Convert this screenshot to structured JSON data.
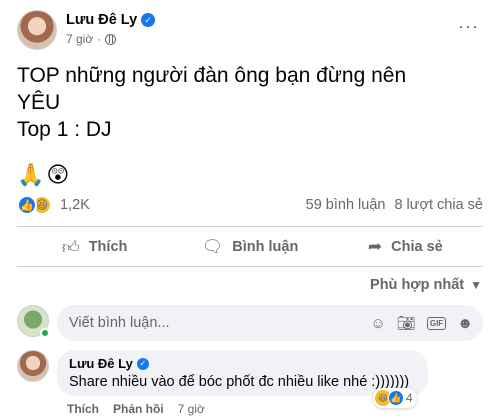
{
  "post": {
    "author": "Lưu Đê Ly",
    "time": "7 giờ",
    "more": "···",
    "line1": "TOP những người đàn ông bạn đừng nên",
    "line2": "YÊU",
    "line3": "Top 1 : DJ",
    "emojis": "🙏😲"
  },
  "reactions": {
    "count": "1,2K",
    "comments": "59 bình luận",
    "shares": "8 lượt chia sẻ"
  },
  "actions": {
    "like": "Thích",
    "comment": "Bình luận",
    "share": "Chia sẻ"
  },
  "sort": {
    "label": "Phù hợp nhất"
  },
  "comment_box": {
    "placeholder": "Viết bình luận..."
  },
  "comment": {
    "author": "Lưu Đê Ly",
    "text": "Share nhiều vào để bóc phốt đc nhiều like nhé :)))))))",
    "reaction_count": "4",
    "like": "Thích",
    "reply": "Phản hồi",
    "time": "7 giờ"
  },
  "colors": {
    "accent": "#1877f2",
    "muted": "#65676b",
    "bubble": "#f0f2f5",
    "haha": "#f7b928"
  },
  "icons": [
    "verified-icon",
    "globe-icon",
    "more-icon",
    "like-icon",
    "haha-icon",
    "comment-icon",
    "share-icon",
    "chevron-down-icon",
    "emoji-icon",
    "camera-icon",
    "gif-icon",
    "sticker-icon"
  ]
}
